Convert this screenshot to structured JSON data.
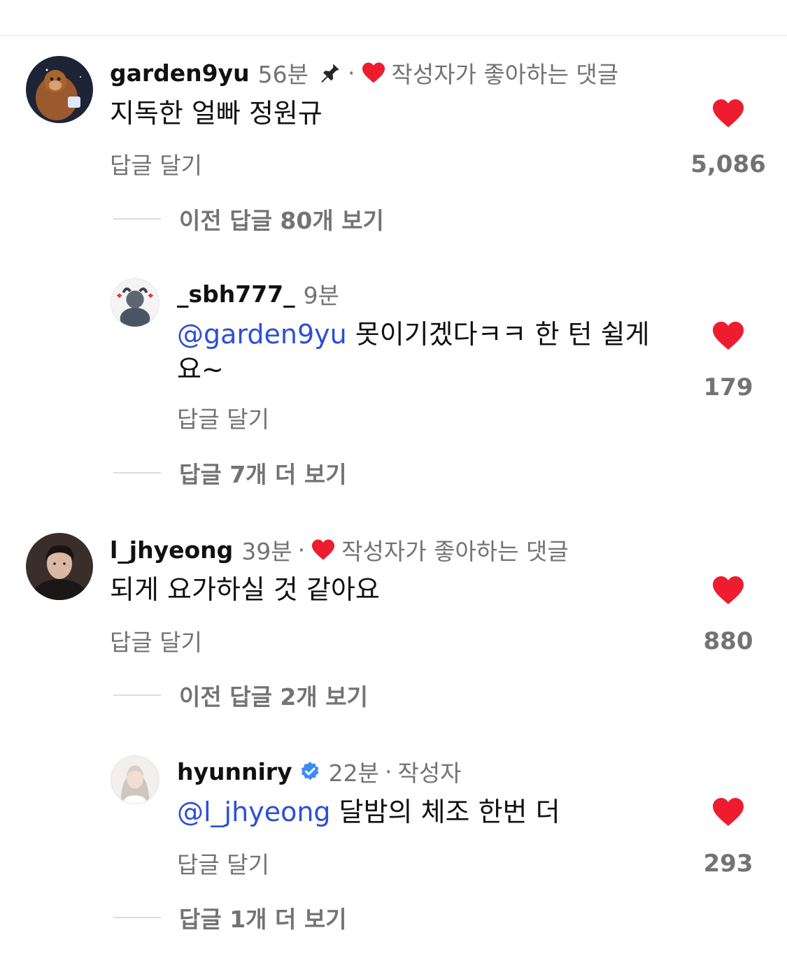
{
  "comments": [
    {
      "username": "garden9yu",
      "time": "56분",
      "pinned": true,
      "creator_liked_label": "작성자가 좋아하는 댓글",
      "text": "지독한 얼빠 정원규",
      "reply_label": "답글 달기",
      "likes": "5,086",
      "thread_label": "이전 답글 80개 보기",
      "reply": {
        "username": "_sbh777_",
        "time": "9분",
        "mention": "@garden9yu",
        "text": " 못이기겠다ㅋㅋ 한 턴 쉴게요~",
        "reply_label": "답글 달기",
        "likes": "179",
        "thread_label": "답글 7개 더 보기"
      }
    },
    {
      "username": "l_jhyeong",
      "time": "39분",
      "creator_liked_label": "작성자가 좋아하는 댓글",
      "text": "되게 요가하실 것 같아요",
      "reply_label": "답글 달기",
      "likes": "880",
      "thread_label": "이전 답글 2개 보기",
      "reply": {
        "username": "hyunniry",
        "verified": true,
        "time": "22분",
        "author_label": "작성자",
        "mention": "@l_jhyeong",
        "text": " 달밤의 체조 한번 더",
        "reply_label": "답글 달기",
        "likes": "293",
        "thread_label": "답글 1개 더 보기"
      }
    }
  ],
  "colors": {
    "heart": "#ed1c2e",
    "mention": "#2c4fd6",
    "muted": "#737373",
    "verified": "#3b8cf5"
  },
  "icons": [
    "pin-icon",
    "heart-icon",
    "verified-badge-icon"
  ]
}
